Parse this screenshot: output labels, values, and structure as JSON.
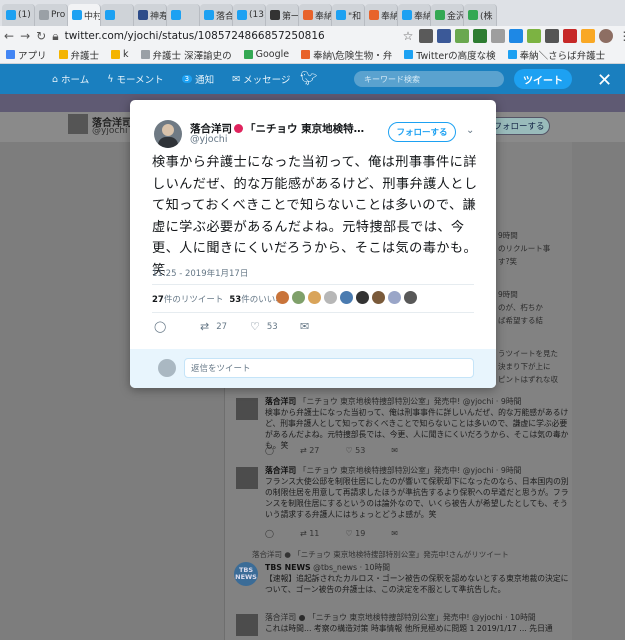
{
  "browser": {
    "tabs": [
      {
        "label": "(1)",
        "color": "#1da1f2"
      },
      {
        "label": "Pro",
        "color": "#9aa0a6"
      },
      {
        "label": "中村",
        "color": "#1da1f2",
        "active": true
      },
      {
        "label": "",
        "color": "#1da1f2"
      },
      {
        "label": "神寿",
        "color": "#2d4c8a"
      },
      {
        "label": "",
        "color": "#1da1f2"
      },
      {
        "label": "落合",
        "color": "#1da1f2"
      },
      {
        "label": "(13)",
        "color": "#1da1f2"
      },
      {
        "label": "第一",
        "color": "#333333"
      },
      {
        "label": "奉納",
        "color": "#e8632b"
      },
      {
        "label": "\"和",
        "color": "#1da1f2"
      },
      {
        "label": "奉納",
        "color": "#e8632b"
      },
      {
        "label": "奉納",
        "color": "#1da1f2"
      },
      {
        "label": "金沢",
        "color": "#34a853"
      },
      {
        "label": "(株",
        "color": "#34a853"
      }
    ],
    "url": "twitter.com/yjochi/status/1085724866857250816",
    "bookmarks": [
      {
        "label": "アプリ",
        "color": "#4285f4"
      },
      {
        "label": "弁護士",
        "color": "#f4b400"
      },
      {
        "label": "k",
        "color": "#f4b400"
      },
      {
        "label": "弁護士 深澤諭史の",
        "color": "#9aa0a6"
      },
      {
        "label": "Google",
        "color": "#34a853"
      },
      {
        "label": "奉納\\危険生物・弁",
        "color": "#e8632b"
      },
      {
        "label": "Twitterの高度な検",
        "color": "#1da1f2"
      },
      {
        "label": "奉納＼さらば弁護士",
        "color": "#1da1f2"
      }
    ]
  },
  "twitter_nav": {
    "home": "ホーム",
    "moments": "モーメント",
    "notifications": "通知",
    "notifications_badge": "3",
    "messages": "メッセージ",
    "search_placeholder": "キーワード検索",
    "tweet_button": "ツイート",
    "close": "✕"
  },
  "profile_header": {
    "name": "落合洋司",
    "handle": "@yjochi",
    "follow_button": "フォローする"
  },
  "modal": {
    "author_name": "落合洋司",
    "author_name_rest": "「ニチョウ 東京地検特捜...",
    "author_handle": "@yjochi",
    "follow_button": "フォローする",
    "text": "検事から弁護士になった当初って、俺は刑事事件に詳しいんだぜ、的な万能感があるけど、刑事弁護人として知っておくべきことで知らないことは多いので、謙虚に学ぶ必要があるんだよね。元特捜部長では、今更、人に聞きにくいだろうから、そこは気の毒かも。笑",
    "timestamp": "11:25 - 2019年1月17日",
    "retweet_count": "27",
    "retweet_label": "件のリツイート",
    "like_count": "53",
    "like_label": "件のいいね",
    "liker_colors": [
      "#c9743a",
      "#7fa06a",
      "#d9a45a",
      "#b7b7b7",
      "#4a7bb0",
      "#333333",
      "#7a5a3a",
      "#9aa6c8",
      "#585858"
    ],
    "actions": {
      "reply": "",
      "retweet": "27",
      "like": "53"
    },
    "reply_placeholder": "返信をツイート"
  },
  "background": {
    "right_column": [
      "9時間",
      "のリクルート事",
      "す?笑",
      "9時間",
      "のが、朽ちか",
      "ば希望する結",
      "うツイートを見た",
      "決まり下が上に",
      "ピントはずれな収"
    ],
    "tweets": [
      {
        "name": "落合洋司",
        "badge": "「ニチョウ 東京地検特捜部特別公室」発売中!",
        "handle": "@yjochi",
        "time": "9時間",
        "text": "検事から弁護士になった当初って、俺は刑事事件に詳しいんだぜ、的な万能感があるけど、刑事弁護人として知っておくべきことで知らないことは多いので、謙虚に学ぶ必要があるんだよね。元特捜部長では、今更、人に聞きにくいだろうから、そこは気の毒かも。笑",
        "reply_count": "",
        "retweet_count": "27",
        "like_count": "53"
      },
      {
        "name": "落合洋司",
        "badge": "「ニチョウ 東京地検特捜部特別公室」発売中!",
        "handle": "@yjochi",
        "time": "9時間",
        "text": "フランス大使公邸を制限住居にしたのが響いて保釈却下になったのなら、日本国内の別の制限住居を用意して再請求したほうが準抗告するより保釈への早道だと思うが。フランスを制限住居にするというのは論外なので、いくら被告人が希望したとしても、そういう請求する弁護人にはちょっとどうよ感が。笑",
        "reply_count": "",
        "retweet_count": "11",
        "like_count": "19"
      }
    ],
    "retweet_note": "落合洋司 ● 「ニチョウ 東京地検特捜部特別公室」発売中!さんがリツイート",
    "tbs": {
      "logo": "TBS NEWS",
      "name": "TBS NEWS",
      "handle": "@tbs_news",
      "time": "10時間",
      "text": "【速報】追起訴されたカルロス・ゴーン被告の保釈を認めないとする東京地裁の決定について、ゴーン被告の弁護士は、この決定を不服として準抗告した。"
    },
    "last_tweet": {
      "header": "落合洋司 ● 「ニチョウ 東京地検特捜部特別公室」発売中! @yjochi · 10時間",
      "text": "これは時間... 考察の構造対策 時事情報 他所見極めに問題 1 2019/1/17 ... 先日通"
    }
  }
}
